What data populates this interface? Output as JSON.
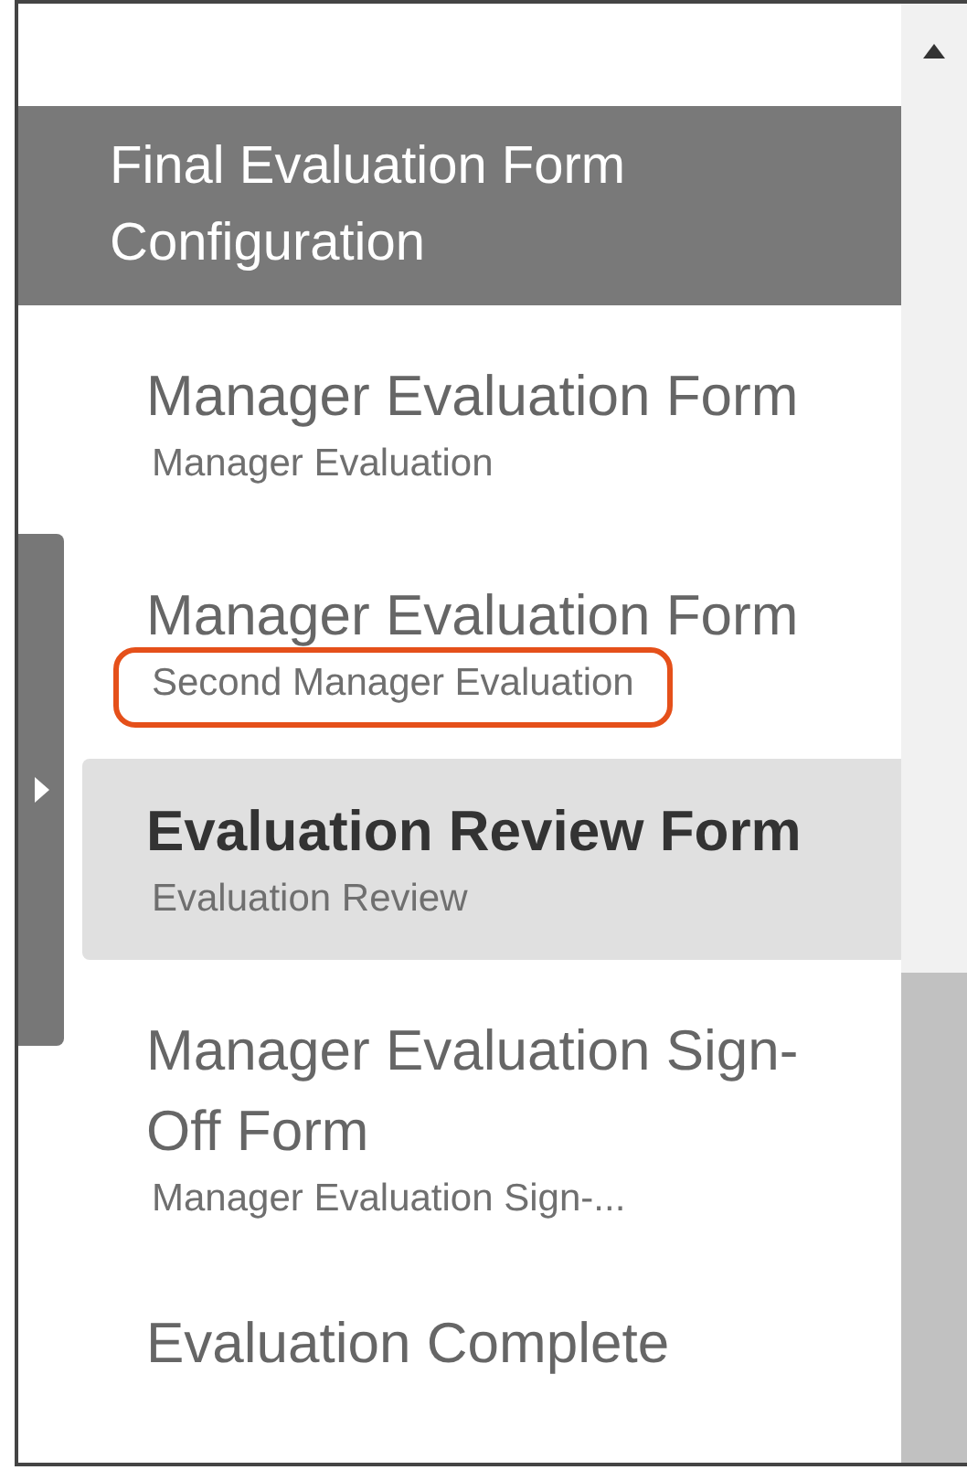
{
  "section": {
    "title": "Final Evaluation Form Configuration"
  },
  "items": [
    {
      "title": "Manager Evaluation Form",
      "subtitle": "Manager Evaluation",
      "selected": false,
      "highlighted": false
    },
    {
      "title": "Manager Evaluation Form",
      "subtitle": "Second Manager Evaluation",
      "selected": false,
      "highlighted": true
    },
    {
      "title": "Evaluation Review Form",
      "subtitle": "Evaluation Review",
      "selected": true,
      "highlighted": false
    },
    {
      "title": "Manager Evaluation Sign-Off Form",
      "subtitle": "Manager Evaluation Sign-...",
      "selected": false,
      "highlighted": false
    }
  ],
  "item_below": {
    "title": "Evaluation Complete"
  }
}
